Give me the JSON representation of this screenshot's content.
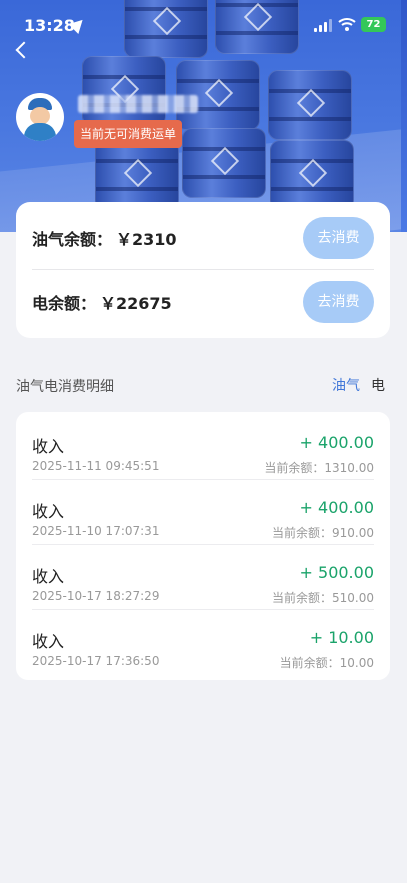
{
  "status_bar": {
    "time": "13:28",
    "battery": "72"
  },
  "user": {
    "tag": "当前无可消费运单"
  },
  "balances": [
    {
      "label": "油气余额：",
      "value": "￥2310",
      "button": "去消费"
    },
    {
      "label": "电余额：",
      "value": "￥22675",
      "button": "去消费"
    }
  ],
  "details": {
    "title": "油气电消费明细",
    "tabs": {
      "oil": "油气",
      "electric": "电"
    },
    "active_tab": "油气"
  },
  "transactions": [
    {
      "type": "收入",
      "date": "2025-11-11 09:45:51",
      "amount": "+ 400.00",
      "balance": "当前余额：1310.00"
    },
    {
      "type": "收入",
      "date": "2025-11-10 17:07:31",
      "amount": "+ 400.00",
      "balance": "当前余额：910.00"
    },
    {
      "type": "收入",
      "date": "2025-10-17 18:27:29",
      "amount": "+ 500.00",
      "balance": "当前余额：510.00"
    },
    {
      "type": "收入",
      "date": "2025-10-17 17:36:50",
      "amount": "+ 10.00",
      "balance": "当前余额：10.00"
    }
  ],
  "colors": {
    "accent": "#3f76d8",
    "income": "#1aa36a",
    "tag": "#e66a4c",
    "button": "#a7cbf7"
  },
  "icons": [
    "location-arrow-icon",
    "signal-icon",
    "wifi-icon",
    "battery-icon",
    "back-icon",
    "avatar-icon"
  ]
}
